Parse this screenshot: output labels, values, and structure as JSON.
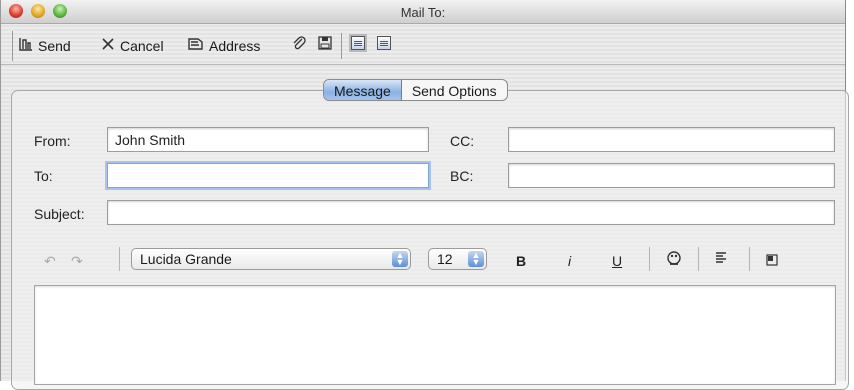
{
  "window": {
    "title": "Mail To:"
  },
  "toolbar": {
    "send_label": "Send",
    "cancel_label": "Cancel",
    "address_label": "Address",
    "icons": [
      "send-icon",
      "cancel-icon",
      "address-book-icon",
      "attachment-icon",
      "save-icon",
      "view-layout-icon",
      "view-layout-alt-icon"
    ]
  },
  "tabs": [
    {
      "label": "Message",
      "selected": true
    },
    {
      "label": "Send Options",
      "selected": false
    }
  ],
  "fields": {
    "from": {
      "label": "From:",
      "value": "John Smith"
    },
    "cc": {
      "label": "CC:",
      "value": ""
    },
    "to": {
      "label": "To:",
      "value": ""
    },
    "bc": {
      "label": "BC:",
      "value": ""
    },
    "subject": {
      "label": "Subject:",
      "value": ""
    }
  },
  "format": {
    "font": "Lucida Grande",
    "size": "12",
    "bold": "B",
    "italic": "i",
    "underline": "U"
  },
  "body": {
    "value": ""
  },
  "colors": {
    "accent": "#8bb2e3",
    "focus_ring": "#a8c4ec"
  }
}
